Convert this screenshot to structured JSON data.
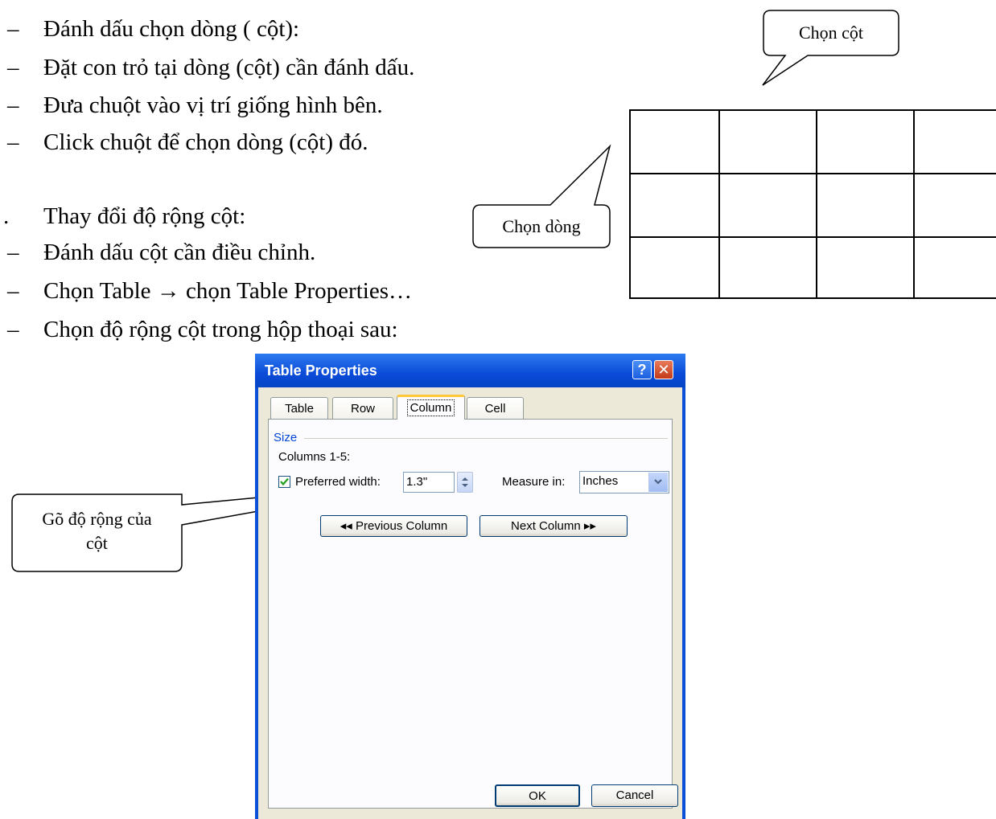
{
  "document": {
    "lines": [
      {
        "marker": "–",
        "text": "Đánh dấu chọn dòng ( cột):"
      },
      {
        "marker": "–",
        "text": "Đặt con trỏ tại dòng (cột) cần đánh dấu."
      },
      {
        "marker": "–",
        "text": "Đưa chuột vào vị trí giống hình bên."
      },
      {
        "marker": "–",
        "text": "Click chuột để chọn dòng (cột) đó."
      },
      {
        "marker": ".",
        "text": "Thay đổi độ rộng cột:"
      },
      {
        "marker": "–",
        "text": "Đánh dấu cột cần điều chỉnh."
      },
      {
        "marker": "–",
        "text": "Chọn Table → chọn Table Properties…"
      },
      {
        "marker": "–",
        "text": "Chọn độ rộng cột trong hộp thoại sau:"
      }
    ]
  },
  "callouts": {
    "select_column": "Chọn cột",
    "select_row": "Chọn dòng",
    "width_hint_line1": "Gõ độ rộng của",
    "width_hint_line2": "cột"
  },
  "dialog": {
    "title": "Table Properties",
    "help_symbol": "?",
    "close_symbol": "✕",
    "tabs": [
      {
        "label": "Table",
        "active": false
      },
      {
        "label": "Row",
        "active": false
      },
      {
        "label": "Column",
        "active": true
      },
      {
        "label": "Cell",
        "active": false
      }
    ],
    "size_label": "Size",
    "columns_label": "Columns 1-5:",
    "preferred_width_checked": true,
    "preferred_width_label": "Preferred width:",
    "preferred_width_value": "1.3\"",
    "measure_in_label": "Measure in:",
    "measure_in_value": "Inches",
    "previous_column_button": "◂◂ Previous Column",
    "next_column_button": "Next Column ▸▸",
    "ok_button": "OK",
    "cancel_button": "Cancel"
  },
  "colors": {
    "titlebar": "#0a4ad8",
    "dialog_face": "#ece9d8",
    "size_label": "#0046d5",
    "active_tab_accent": "#ffc83c"
  }
}
